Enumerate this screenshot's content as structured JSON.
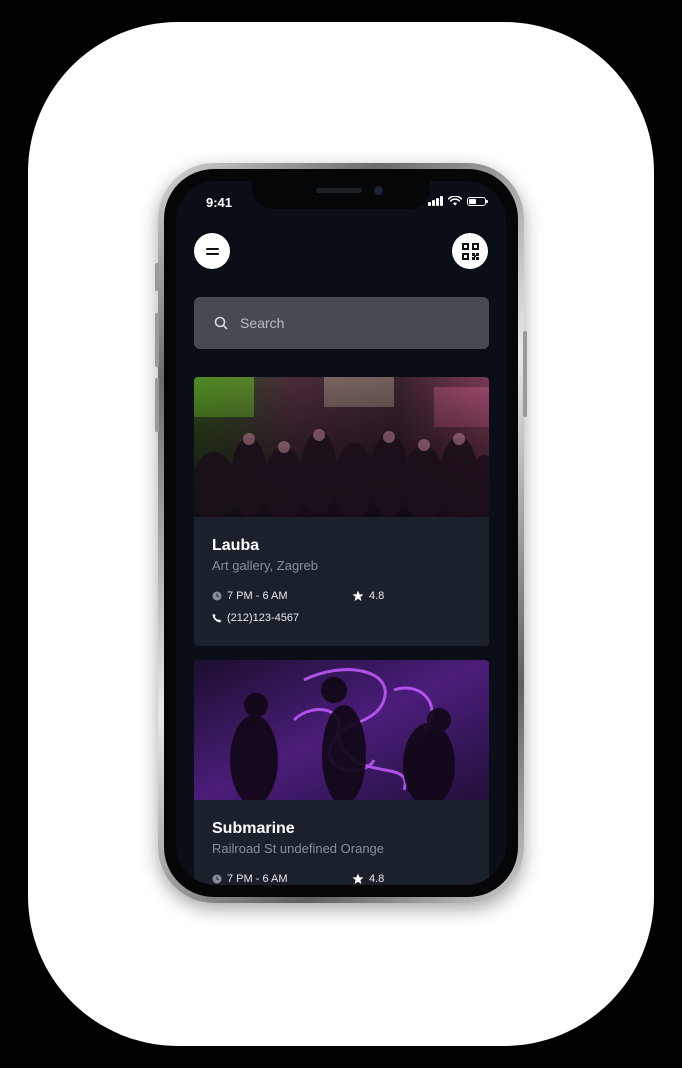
{
  "status": {
    "time": "9:41"
  },
  "header": {
    "menu_icon": "menu-icon",
    "qr_icon": "qr-code-icon"
  },
  "search": {
    "placeholder": "Search",
    "icon": "search-icon"
  },
  "venues": [
    {
      "name": "Lauba",
      "category": "Art gallery, Zagreb",
      "hours": "7 PM - 6 AM",
      "rating": "4.8",
      "phone": "(212)123-4567"
    },
    {
      "name": "Submarine",
      "category": "Railroad St undefined Orange",
      "hours": "7 PM - 6 AM",
      "rating": "4.8"
    }
  ],
  "colors": {
    "screen_bg": "#0a0f17",
    "card_bg": "#1b212b",
    "search_bg": "#454a53",
    "text_muted": "#8a8f97"
  }
}
